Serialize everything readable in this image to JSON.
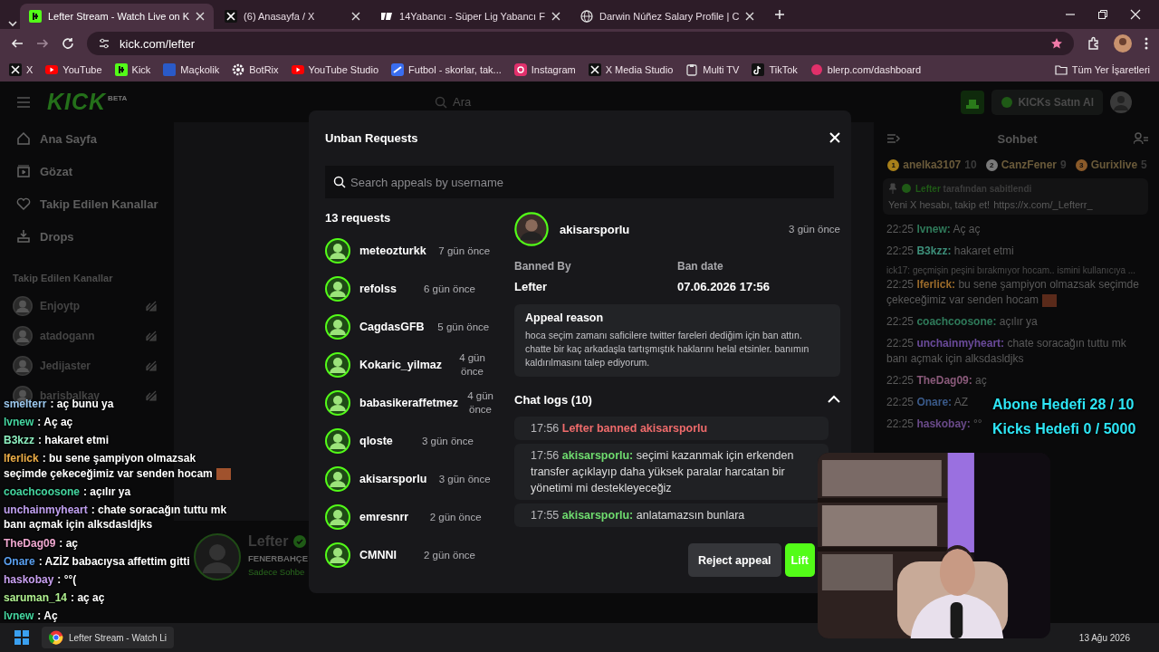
{
  "browser": {
    "tabs": [
      {
        "title": "Lefter Stream - Watch Live on K",
        "kind": "kick",
        "selected": true
      },
      {
        "title": "(6) Anasayfa / X",
        "kind": "x",
        "selected": false
      },
      {
        "title": "14Yabancı - Süper Lig Yabancı F",
        "kind": "fourteen",
        "selected": false
      },
      {
        "title": "Darwin Núñez Salary Profile | C",
        "kind": "globe",
        "selected": false
      }
    ],
    "url": "kick.com/lefter",
    "bookmarks": [
      {
        "label": "X",
        "kind": "x"
      },
      {
        "label": "YouTube",
        "kind": "youtube"
      },
      {
        "label": "Kick",
        "kind": "kick"
      },
      {
        "label": "Maçkolik",
        "kind": "m"
      },
      {
        "label": "BotRix",
        "kind": "gear"
      },
      {
        "label": "YouTube Studio",
        "kind": "youtube"
      },
      {
        "label": "Futbol - skorlar, tak...",
        "kind": "futbol"
      },
      {
        "label": "Instagram",
        "kind": "instagram"
      },
      {
        "label": "X Media Studio",
        "kind": "x"
      },
      {
        "label": "Multi TV",
        "kind": "clipboard"
      },
      {
        "label": "TikTok",
        "kind": "tiktok"
      },
      {
        "label": "blerp.com/dashboard",
        "kind": "blerp"
      }
    ],
    "all_bookmarks": "Tüm Yer İşaretleri"
  },
  "site": {
    "logo": "KICK",
    "logo_tag": "BETA",
    "search_placeholder": "Ara",
    "buy_button": "KICKs Satın Al",
    "nav": [
      {
        "label": "Ana Sayfa",
        "kind": "home"
      },
      {
        "label": "Gözat",
        "kind": "browse"
      },
      {
        "label": "Takip Edilen Kanallar",
        "kind": "heart"
      },
      {
        "label": "Drops",
        "kind": "drops"
      }
    ],
    "followed_title": "Takip Edilen Kanallar",
    "followed": [
      "Enjoytp",
      "atadogann",
      "Jedijaster",
      "barisbalkay"
    ],
    "streamer": {
      "name": "Lefter",
      "team": "FENERBAHÇE",
      "mode": "Sadece Sohbe"
    }
  },
  "chat": {
    "title": "Sohbet",
    "leaders": [
      {
        "rank": "1",
        "name": "anelka3107",
        "score": "10",
        "color": "#a8801a"
      },
      {
        "rank": "2",
        "name": "CanzFener",
        "score": "9",
        "color": "#7a7a7a"
      },
      {
        "rank": "3",
        "name": "Gurixlive",
        "score": "5",
        "color": "#8a5a2a"
      }
    ],
    "pinned": {
      "by": "Lefter",
      "note": "tarafından sabitlendi",
      "text": "Yeni X hesabı, takip et!",
      "link": "https://x.com/_Lefterr_"
    },
    "messages": [
      {
        "kind": "message",
        "time": "22:25",
        "user": "lvnew:",
        "text": "Aç aç",
        "color": "#2f7a5a",
        "emote": false
      },
      {
        "kind": "message",
        "time": "22:25",
        "user": "B3kzz:",
        "text": "hakaret etmi",
        "color": "#3d8f7a",
        "emote": false
      },
      {
        "kind": "reply",
        "text": "ick17: geçmişin peşini bırakmıyor hocam.. ismini kullanıcıya ..."
      },
      {
        "kind": "message",
        "time": "22:25",
        "user": "lferlick:",
        "text": "bu sene şampiyon olmazsak seçimde çekeceğimiz var senden hocam",
        "color": "#9a6a2a",
        "emote": true
      },
      {
        "kind": "message",
        "time": "22:25",
        "user": "coachcoosone:",
        "text": "açılır ya",
        "color": "#2f7a5a",
        "emote": false
      },
      {
        "kind": "message",
        "time": "22:25",
        "user": "unchainmyheart:",
        "text": "chate soracağın tuttu mk banı açmak için alksdasldjks",
        "color": "#6a4a9a",
        "emote": false
      },
      {
        "kind": "message",
        "time": "22:25",
        "user": "TheDag09:",
        "text": "aç",
        "color": "#8a5a7a",
        "emote": false
      },
      {
        "kind": "message",
        "time": "22:25",
        "user": "Onare:",
        "text": "AZ",
        "color": "#3a5a8a",
        "emote": false
      },
      {
        "kind": "message",
        "time": "22:25",
        "user": "haskobay:",
        "text": "°°",
        "color": "#6a4a8a",
        "emote": false
      }
    ]
  },
  "modal": {
    "title": "Unban Requests",
    "search_placeholder": "Search appeals by username",
    "count": "13 requests",
    "requests": [
      {
        "name": "meteozturkk",
        "time": "7 gün önce"
      },
      {
        "name": "refolss",
        "time": "6 gün önce"
      },
      {
        "name": "CagdasGFB",
        "time": "5 gün önce"
      },
      {
        "name": "Kokaric_yilmaz",
        "time": "4 gün önce"
      },
      {
        "name": "babasikeraffetmez",
        "time": "4 gün önce"
      },
      {
        "name": "qloste",
        "time": "3 gün önce"
      },
      {
        "name": "akisarsporlu",
        "time": "3 gün önce"
      },
      {
        "name": "emresnrr",
        "time": "2 gün önce"
      },
      {
        "name": "CMNNI",
        "time": "2 gün önce"
      }
    ],
    "detail": {
      "name": "akisarsporlu",
      "time": "3 gün önce",
      "banned_by_label": "Banned By",
      "banned_by": "Lefter",
      "ban_date_label": "Ban date",
      "ban_date": "07.06.2026 17:56",
      "reason_title": "Appeal reason",
      "reason": "hoca seçim zamanı saficilere twitter fareleri dediğim için ban attın. chatte bir kaç arkadaşla tartışmıştık haklarını helal etsinler. banımın kaldırılmasını talep ediyorum.",
      "logs_title": "Chat logs (10)",
      "logs_expanded": true,
      "logs": [
        {
          "kind": "ban",
          "time": "17:56",
          "text": "Lefter banned akisarsporlu"
        },
        {
          "kind": "message",
          "time": "17:56",
          "user": "akisarsporlu:",
          "text": "seçimi kazanmak için erkenden transfer açıklayıp daha yüksek paralar harcatan bir yönetimi mi destekleyeceğiz"
        },
        {
          "kind": "message",
          "time": "17:55",
          "user": "akisarsporlu:",
          "text": "anlatamazsın bunlara"
        }
      ]
    },
    "buttons": [
      {
        "label": "Reject appeal",
        "kind": "secondary"
      },
      {
        "label": "Lift",
        "kind": "primary"
      }
    ]
  },
  "overlay_chat": [
    {
      "user": "smelterr",
      "text": ": aç bunu ya",
      "color": "#9cc8ee",
      "emote": false
    },
    {
      "user": "lvnew",
      "text": ": Aç aç",
      "color": "#45d6a0",
      "emote": false
    },
    {
      "user": "B3kzz",
      "text": ": hakaret etmi",
      "color": "#8ef0c0",
      "emote": false
    },
    {
      "user": "lferlick",
      "text": ": bu sene şampiyon olmazsak seçimde çekeceğimiz var senden hocam",
      "color": "#f0b048",
      "emote": true
    },
    {
      "user": "coachcoosone",
      "text": ": açılır ya",
      "color": "#45d6a0",
      "emote": false
    },
    {
      "user": "unchainmyheart",
      "text": ": chate soracağın tuttu mk banı açmak için alksdasldjks",
      "color": "#c0a0f0",
      "emote": false
    },
    {
      "user": "TheDag09",
      "text": ": aç",
      "color": "#f0a8d0",
      "emote": false
    },
    {
      "user": "Onare",
      "text": ": AZİZ babacıysa affettim gitti",
      "color": "#5aa0f0",
      "emote": false
    },
    {
      "user": "haskobay",
      "text": ": °°(",
      "color": "#c8a0f0",
      "emote": false
    },
    {
      "user": "saruman_14",
      "text": ": aç aç",
      "color": "#b0f090",
      "emote": false
    },
    {
      "user": "lvnew",
      "text": ": Aç",
      "color": "#45d6a0",
      "emote": false
    }
  ],
  "goals": [
    "Abone Hedefi 28 / 10",
    "Kicks Hedefi 0 / 5000"
  ],
  "taskbar": {
    "window": "Lefter Stream - Watch Li",
    "date": "13 Ağu 2026"
  }
}
